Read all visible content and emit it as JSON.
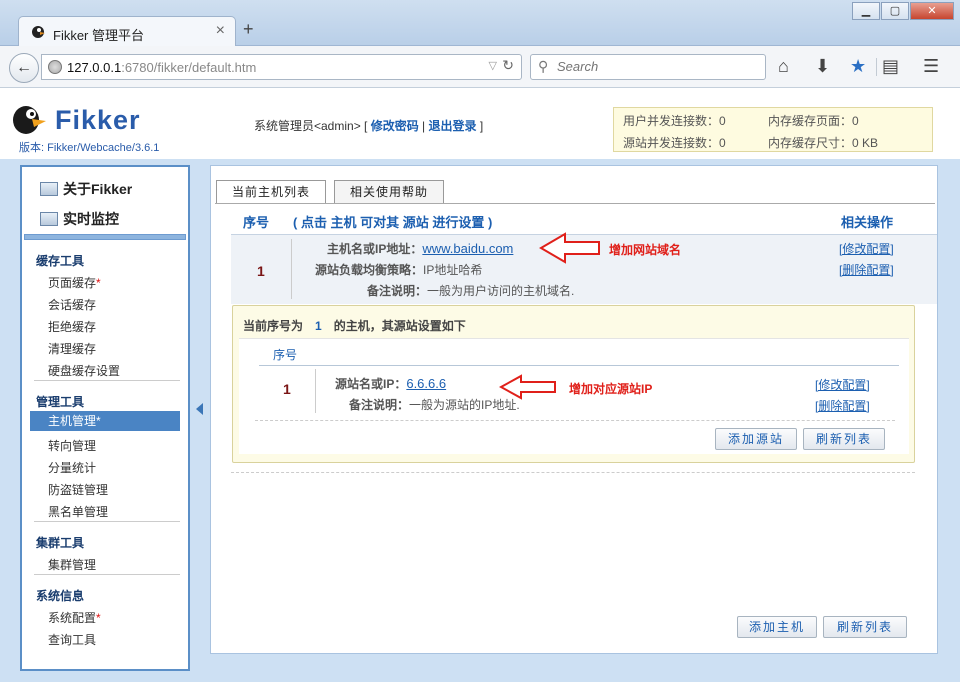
{
  "browser": {
    "tab_title": "Fikker 管理平台",
    "tab_close": "×",
    "new_tab": "+",
    "url_host": "127.0.0.1",
    "url_rest": ":6780/fikker/default.htm",
    "search_placeholder": "Search",
    "win_min": "▁",
    "win_max": "▢",
    "win_close": "✕",
    "back": "←",
    "reload": "↻",
    "dropdown": "▽",
    "search_glyph": "⚲",
    "home_glyph": "⌂",
    "download_glyph": "⬇",
    "star_glyph": "★",
    "reader_glyph": "▤",
    "menu_glyph": "☰"
  },
  "header": {
    "logo": "Fikker",
    "version": "版本: Fikker/Webcache/3.6.1",
    "user_prefix": "系统管理员<admin> [ ",
    "change_password": "修改密码",
    "sep": " | ",
    "logout": "退出登录",
    "user_suffix": " ]",
    "stats": {
      "user_conn": "用户并发连接数：0",
      "origin_conn": "源站并发连接数：0",
      "mem_pages": "内存缓存页面：0",
      "mem_size": "内存缓存尺寸：0 KB"
    }
  },
  "sidebar": {
    "about": "关于Fikker",
    "monitor": "实时监控",
    "groups": {
      "cache": "缓存工具",
      "manage": "管理工具",
      "cluster": "集群工具",
      "sysinfo": "系统信息"
    },
    "items": {
      "page_cache": "页面缓存",
      "session_cache": "会话缓存",
      "reject_cache": "拒绝缓存",
      "clear_cache": "清理缓存",
      "disk_cache": "硬盘缓存设置",
      "host_manage": "主机管理",
      "redirect": "转向管理",
      "stats": "分量统计",
      "hotlink": "防盗链管理",
      "blacklist": "黑名单管理",
      "cluster_manage": "集群管理",
      "sys_config": "系统配置",
      "query_tool": "查询工具"
    },
    "star": "*"
  },
  "content": {
    "tabs": [
      "当前主机列表",
      "相关使用帮助"
    ],
    "th_num": "序号",
    "th_hint": "( 点击 主机 可对其 源站 进行设置 )",
    "th_ops": "相关操作",
    "host": {
      "num": "1",
      "hostname_label": "主机名或IP地址：",
      "hostname": "www.baidu.com",
      "lb_label": "源站负载均衡策略：",
      "lb_value": "IP地址哈希",
      "note_label": "备注说明：",
      "note_value": "一般为用户访问的主机域名.",
      "edit": "[修改配置]",
      "delete": "[删除配置]"
    },
    "annot_domain": "增加网站域名",
    "annot_ip": "增加对应源站IP",
    "backend": {
      "title_pre": "当前序号为",
      "title_num": "1",
      "title_post": "的主机，其源站设置如下",
      "th_num": "序号",
      "num": "1",
      "origin_label": "源站名或IP：",
      "origin_value": "6.6.6.6",
      "note_label": "备注说明：",
      "note_value": "一般为源站的IP地址.",
      "edit": "[修改配置]",
      "delete": "[删除配置]",
      "add_origin": "添加源站",
      "refresh": "刷新列表"
    },
    "add_host": "添加主机",
    "refresh": "刷新列表"
  }
}
